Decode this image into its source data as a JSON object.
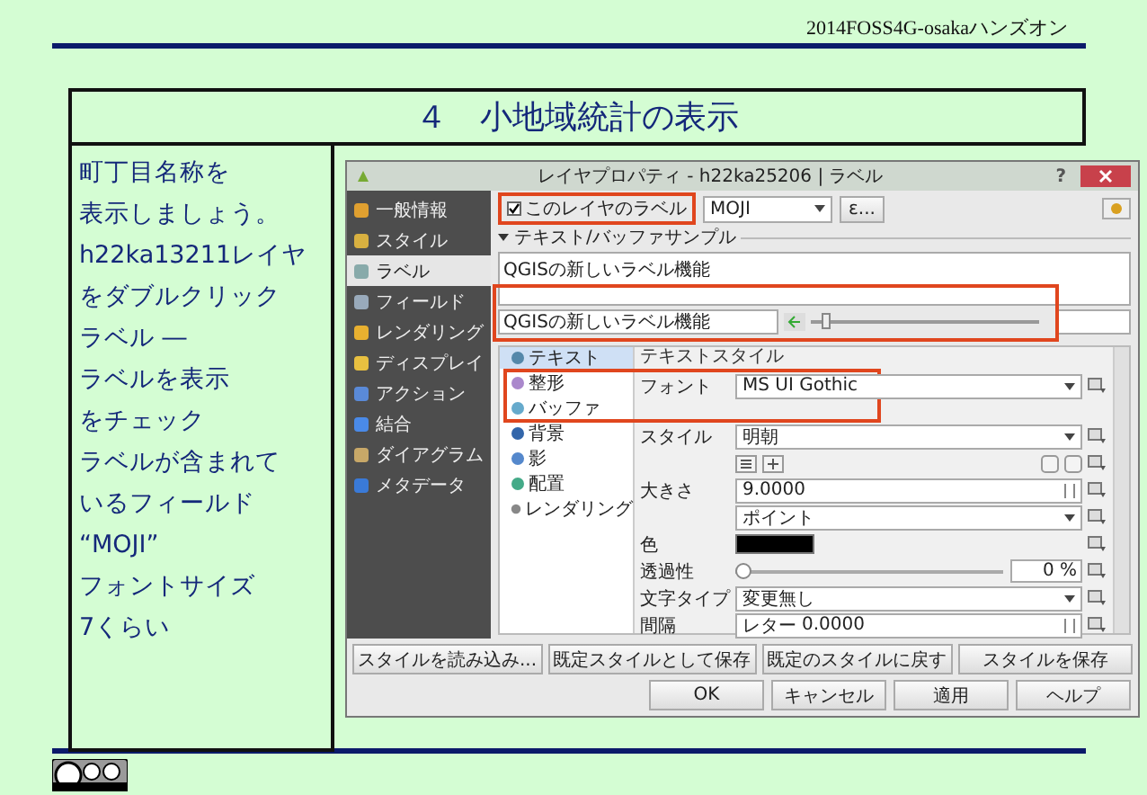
{
  "header": {
    "text": "2014FOSS4G-osakaハンズオン"
  },
  "title": "４　小地域統計の表示",
  "instructions": [
    "町丁目名称を",
    "表示しましょう。",
    "h22ka13211レイヤ",
    "をダブルクリック",
    "ラベル ―",
    "ラベルを表示",
    "をチェック",
    "ラベルが含まれて",
    "いるフィールド",
    "“MOJI”",
    "フォントサイズ",
    "7くらい"
  ],
  "dialog": {
    "title": "レイヤプロパティ - h22ka25206 | ラベル",
    "help": "?",
    "sidebar": [
      {
        "label": "一般情報",
        "selected": false
      },
      {
        "label": "スタイル",
        "selected": false
      },
      {
        "label": "ラベル",
        "selected": true
      },
      {
        "label": "フィールド",
        "selected": false
      },
      {
        "label": "レンダリング",
        "selected": false
      },
      {
        "label": "ディスプレイ",
        "selected": false
      },
      {
        "label": "アクション",
        "selected": false
      },
      {
        "label": "結合",
        "selected": false
      },
      {
        "label": "ダイアグラム",
        "selected": false
      },
      {
        "label": "メタデータ",
        "selected": false
      }
    ],
    "label_toggle": {
      "label": "このレイヤのラベル",
      "checked": true
    },
    "field_combo": "MOJI",
    "expr_button": "ε...",
    "sample_header": "テキスト/バッファサンプル",
    "sample_text": "QGISの新しいラベル機能",
    "sample_input": "QGISの新しいラベル機能",
    "sample_zoom": {
      "level": 0.05
    },
    "tabs": [
      {
        "label": "テキスト",
        "selected": true
      },
      {
        "label": "整形",
        "selected": false
      },
      {
        "label": "バッファ",
        "selected": false
      },
      {
        "label": "背景",
        "selected": false
      },
      {
        "label": "影",
        "selected": false
      },
      {
        "label": "配置",
        "selected": false
      },
      {
        "label": "レンダリング",
        "selected": false
      }
    ],
    "section_title": "テキストスタイル",
    "rows": [
      {
        "kind": "combo",
        "label": "フォント",
        "value": "MS UI Gothic"
      },
      {
        "kind": "combo",
        "label": "スタイル",
        "value": "明朝"
      },
      {
        "kind": "format"
      },
      {
        "kind": "spin",
        "label": "大きさ",
        "value": "9.0000"
      },
      {
        "kind": "combo",
        "value": "ポイント"
      },
      {
        "kind": "color",
        "label": "色",
        "color": "#000000"
      },
      {
        "kind": "slider",
        "label": "透過性",
        "level": 0,
        "value": "0 %"
      },
      {
        "kind": "combo",
        "label": "文字タイプ",
        "value": "変更無し"
      },
      {
        "kind": "spin",
        "label": "間隔",
        "prefix": "レター",
        "value": "0.0000"
      }
    ],
    "style_buttons": [
      "スタイルを読み込み...",
      "既定スタイルとして保存",
      "既定のスタイルに戻す",
      "スタイルを保存"
    ],
    "buttons": [
      "OK",
      "キャンセル",
      "適用",
      "ヘルプ"
    ]
  }
}
